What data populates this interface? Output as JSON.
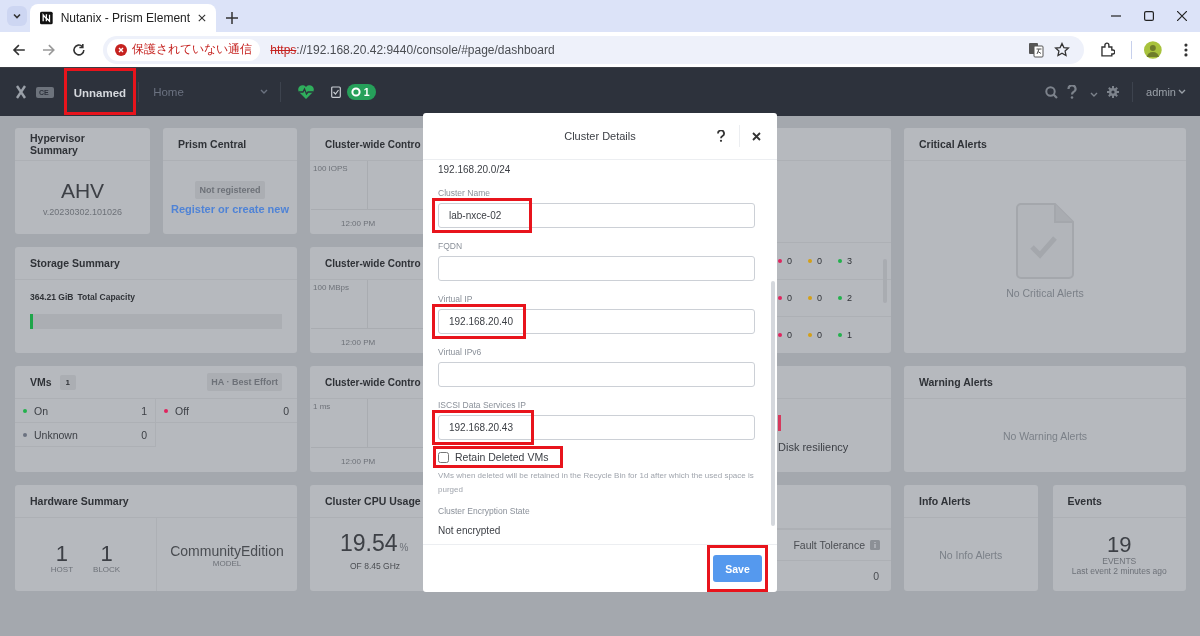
{
  "browser": {
    "tab_title": "Nutanix - Prism Element",
    "security_label": "保護されていない通信",
    "url_scheme": "https",
    "url_rest": "://192.168.20.42:9440/console/#page/dashboard"
  },
  "navbar": {
    "logo_badge": "CE",
    "cluster_name": "Unnamed",
    "cluster_highlighted": true,
    "menu": "Home",
    "task_count": "1",
    "user": "admin"
  },
  "dashboard": {
    "hypervisor": {
      "title": "Hypervisor Summary",
      "name": "AHV",
      "version": "v.20230302.101026"
    },
    "prism_central": {
      "title": "Prism Central",
      "status": "Not registered",
      "link": "Register or create new"
    },
    "storage": {
      "title": "Storage Summary",
      "capacity": "364.21 GiB",
      "capacity_label": "Total Capacity",
      "level": 0.01
    },
    "vms": {
      "title": "VMs",
      "count": "1",
      "ha": "HA · Best Effort",
      "states": [
        {
          "label": "On",
          "value": "1",
          "color": "#22b14c"
        },
        {
          "label": "Off",
          "value": "0",
          "color": "#e0245e"
        },
        {
          "label": "Unknown",
          "value": "0",
          "color": "#6b7280"
        }
      ]
    },
    "hardware": {
      "title": "Hardware Summary",
      "hosts": "1",
      "hosts_label": "HOST",
      "blocks": "1",
      "blocks_label": "BLOCK",
      "model": "CommunityEdition",
      "model_label": "MODEL"
    },
    "cluster_charts": [
      {
        "title": "Cluster-wide Contro",
        "axis_label": "100 IOPS",
        "time": "12:00 PM"
      },
      {
        "title": "Cluster-wide Contro",
        "axis_label": "100 MBps",
        "time": "12:00 PM"
      },
      {
        "title": "Cluster-wide Contro",
        "axis_label": "1 ms",
        "time": "12:00 PM"
      }
    ],
    "cpu": {
      "title": "Cluster CPU Usage",
      "value": "19.54",
      "unit": "%",
      "sub": "OF 8.45 GHz"
    },
    "health_rows": [
      {
        "counts": [
          {
            "value": "0",
            "color": "#e0245e"
          },
          {
            "value": "0",
            "color": "#d4a017"
          },
          {
            "value": "3",
            "color": "#22b14c"
          }
        ]
      },
      {
        "counts": [
          {
            "value": "0",
            "color": "#e0245e"
          },
          {
            "value": "0",
            "color": "#d4a017"
          },
          {
            "value": "2",
            "color": "#22b14c"
          }
        ]
      },
      {
        "counts": [
          {
            "value": "0",
            "color": "#e0245e"
          },
          {
            "value": "0",
            "color": "#d4a017"
          },
          {
            "value": "1",
            "color": "#22b14c"
          }
        ]
      }
    ],
    "resiliency": {
      "label": "Disk resiliency"
    },
    "fault_tolerance": {
      "label": "Fault Tolerance",
      "value": "0"
    },
    "critical_alerts": {
      "title": "Critical Alerts",
      "empty": "No Critical Alerts"
    },
    "warning_alerts": {
      "title": "Warning Alerts",
      "empty": "No Warning Alerts"
    },
    "info_alerts": {
      "title": "Info Alerts",
      "empty": "No Info Alerts"
    },
    "events": {
      "title": "Events",
      "count": "19",
      "label": "EVENTS",
      "last": "Last event 2 minutes ago"
    }
  },
  "modal": {
    "title": "Cluster Details",
    "subnet": "192.168.20.0/24",
    "fields": [
      {
        "label": "Cluster Name",
        "value": "lab-nxce-02",
        "highlighted": true
      },
      {
        "label": "FQDN",
        "highlighted": false
      },
      {
        "label": "Virtual IP",
        "value": "192.168.20.40",
        "highlighted": true
      },
      {
        "label": "Virtual IPv6",
        "highlighted": false
      },
      {
        "label": "ISCSI Data Services IP",
        "value": "192.168.20.43",
        "highlighted": true
      }
    ],
    "checkbox": {
      "label": "Retain Deleted VMs",
      "checked": false,
      "highlighted": true
    },
    "help": "VMs when deleted will be retained in the Recycle Bin for 1d after which the used space is purged",
    "encryption_label": "Cluster Encryption State",
    "encryption_value": "Not encrypted",
    "save": {
      "label": "Save",
      "highlighted": true
    }
  }
}
